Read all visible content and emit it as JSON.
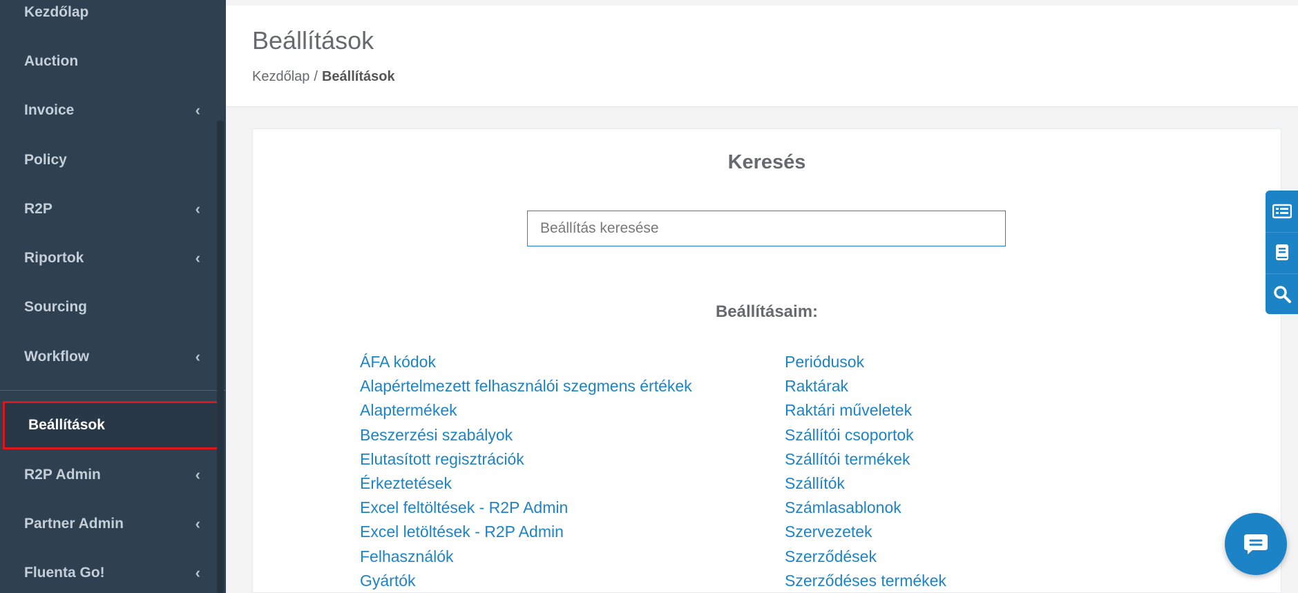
{
  "sidebar": {
    "items": [
      {
        "label": "Kezdőlap",
        "chevron": false
      },
      {
        "label": "Auction",
        "chevron": false
      },
      {
        "label": "Invoice",
        "chevron": true
      },
      {
        "label": "Policy",
        "chevron": false
      },
      {
        "label": "R2P",
        "chevron": true
      },
      {
        "label": "Riportok",
        "chevron": true
      },
      {
        "label": "Sourcing",
        "chevron": false
      },
      {
        "label": "Workflow",
        "chevron": true
      }
    ],
    "active_item": "Beállítások",
    "bottom_items": [
      {
        "label": "R2P Admin",
        "chevron": true
      },
      {
        "label": "Partner Admin",
        "chevron": true
      },
      {
        "label": "Fluenta Go!",
        "chevron": true
      }
    ],
    "chevron_glyph": "‹"
  },
  "header": {
    "title": "Beállítások",
    "breadcrumb": {
      "home": "Kezdőlap",
      "separator": "/",
      "current": "Beállítások"
    }
  },
  "main": {
    "search_title": "Keresés",
    "search_placeholder": "Beállítás keresése",
    "my_settings_title": "Beállításaim:",
    "left_links": [
      "ÁFA kódok",
      "Alapértelmezett felhasználói szegmens értékek",
      "Alaptermékek",
      "Beszerzési szabályok",
      "Elutasított regisztrációk",
      "Érkeztetések",
      "Excel feltöltések - R2P Admin",
      "Excel letöltések - R2P Admin",
      "Felhasználók",
      "Gyártók"
    ],
    "right_links": [
      "Periódusok",
      "Raktárak",
      "Raktári műveletek",
      "Szállítói csoportok",
      "Szállítói termékek",
      "Szállítók",
      "Számlasablonok",
      "Szervezetek",
      "Szerződések",
      "Szerződéses termékek"
    ]
  },
  "floating_tools": [
    "list-icon",
    "book-icon",
    "search-icon"
  ],
  "chat": {
    "icon": "chat-bubble-icon"
  },
  "colors": {
    "sidebar_bg": "#2f4050",
    "accent": "#1c84c6",
    "highlight_border": "#e0161b"
  }
}
